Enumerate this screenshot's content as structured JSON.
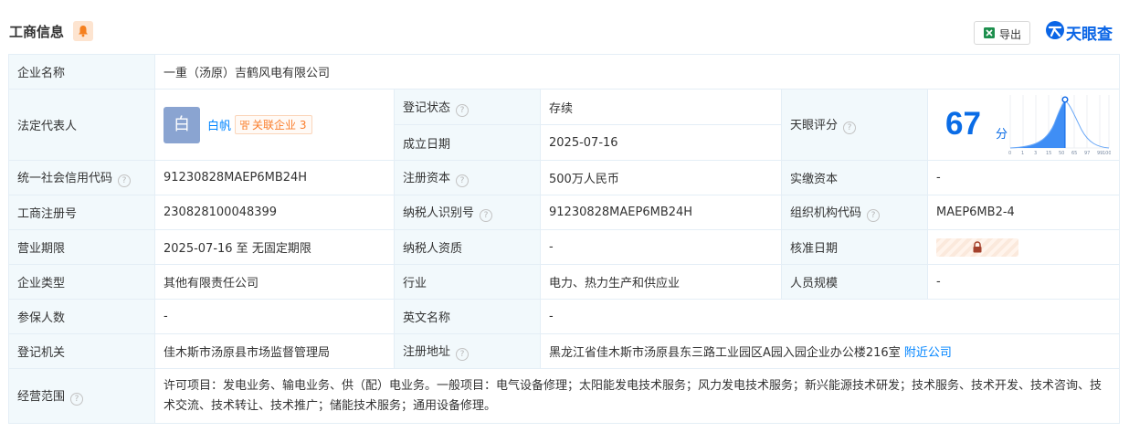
{
  "header": {
    "title": "工商信息",
    "export_label": "导出",
    "brand": "天眼查"
  },
  "rows": {
    "company_name_label": "企业名称",
    "company_name": "一重（汤原）吉鹤风电有限公司",
    "legal_rep_label": "法定代表人",
    "legal_rep_avatar": "白",
    "legal_rep_name": "白帆",
    "related_label": "关联企业",
    "related_count": "3",
    "reg_status_label": "登记状态",
    "reg_status": "存续",
    "founded_label": "成立日期",
    "founded": "2025-07-16",
    "score_label": "天眼评分",
    "score": "67",
    "score_unit": "分",
    "score_ticks": [
      "0",
      "1",
      "3",
      "15",
      "50",
      "65",
      "97",
      "99",
      "100"
    ],
    "credit_code_label": "统一社会信用代码",
    "credit_code": "91230828MAEP6MB24H",
    "reg_capital_label": "注册资本",
    "reg_capital": "500万人民币",
    "paid_capital_label": "实缴资本",
    "paid_capital": "-",
    "reg_no_label": "工商注册号",
    "reg_no": "230828100048399",
    "taxpayer_id_label": "纳税人识别号",
    "taxpayer_id": "91230828MAEP6MB24H",
    "org_code_label": "组织机构代码",
    "org_code": "MAEP6MB2-4",
    "term_label": "营业期限",
    "term": "2025-07-16 至 无固定期限",
    "taxpayer_qual_label": "纳税人资质",
    "taxpayer_qual": "-",
    "approval_date_label": "核准日期",
    "company_type_label": "企业类型",
    "company_type": "其他有限责任公司",
    "industry_label": "行业",
    "industry": "电力、热力生产和供应业",
    "staff_size_label": "人员规模",
    "staff_size": "-",
    "insured_label": "参保人数",
    "insured": "-",
    "english_name_label": "英文名称",
    "english_name": "-",
    "authority_label": "登记机关",
    "authority": "佳木斯市汤原县市场监督管理局",
    "address_label": "注册地址",
    "address": "黑龙江省佳木斯市汤原县东三路工业园区A园入园企业办公楼216室",
    "nearby_link": "附近公司",
    "scope_label": "经营范围",
    "scope": "许可项目：发电业务、输电业务、供（配）电业务。一般项目：电气设备修理；太阳能发电技术服务；风力发电技术服务；新兴能源技术研发；技术服务、技术开发、技术咨询、技术交流、技术转让、技术推广；储能技术服务；通用设备修理。"
  },
  "colors": {
    "label_bg": "#f2f9fc",
    "border": "#e4eef6",
    "status_green": "#31a352",
    "link_blue": "#0084ff",
    "brand_blue": "#0a65e6"
  },
  "icons": [
    "bell-icon",
    "excel-icon",
    "tianyancha-logo-icon",
    "help-icon",
    "related-company-icon",
    "lock-icon"
  ]
}
